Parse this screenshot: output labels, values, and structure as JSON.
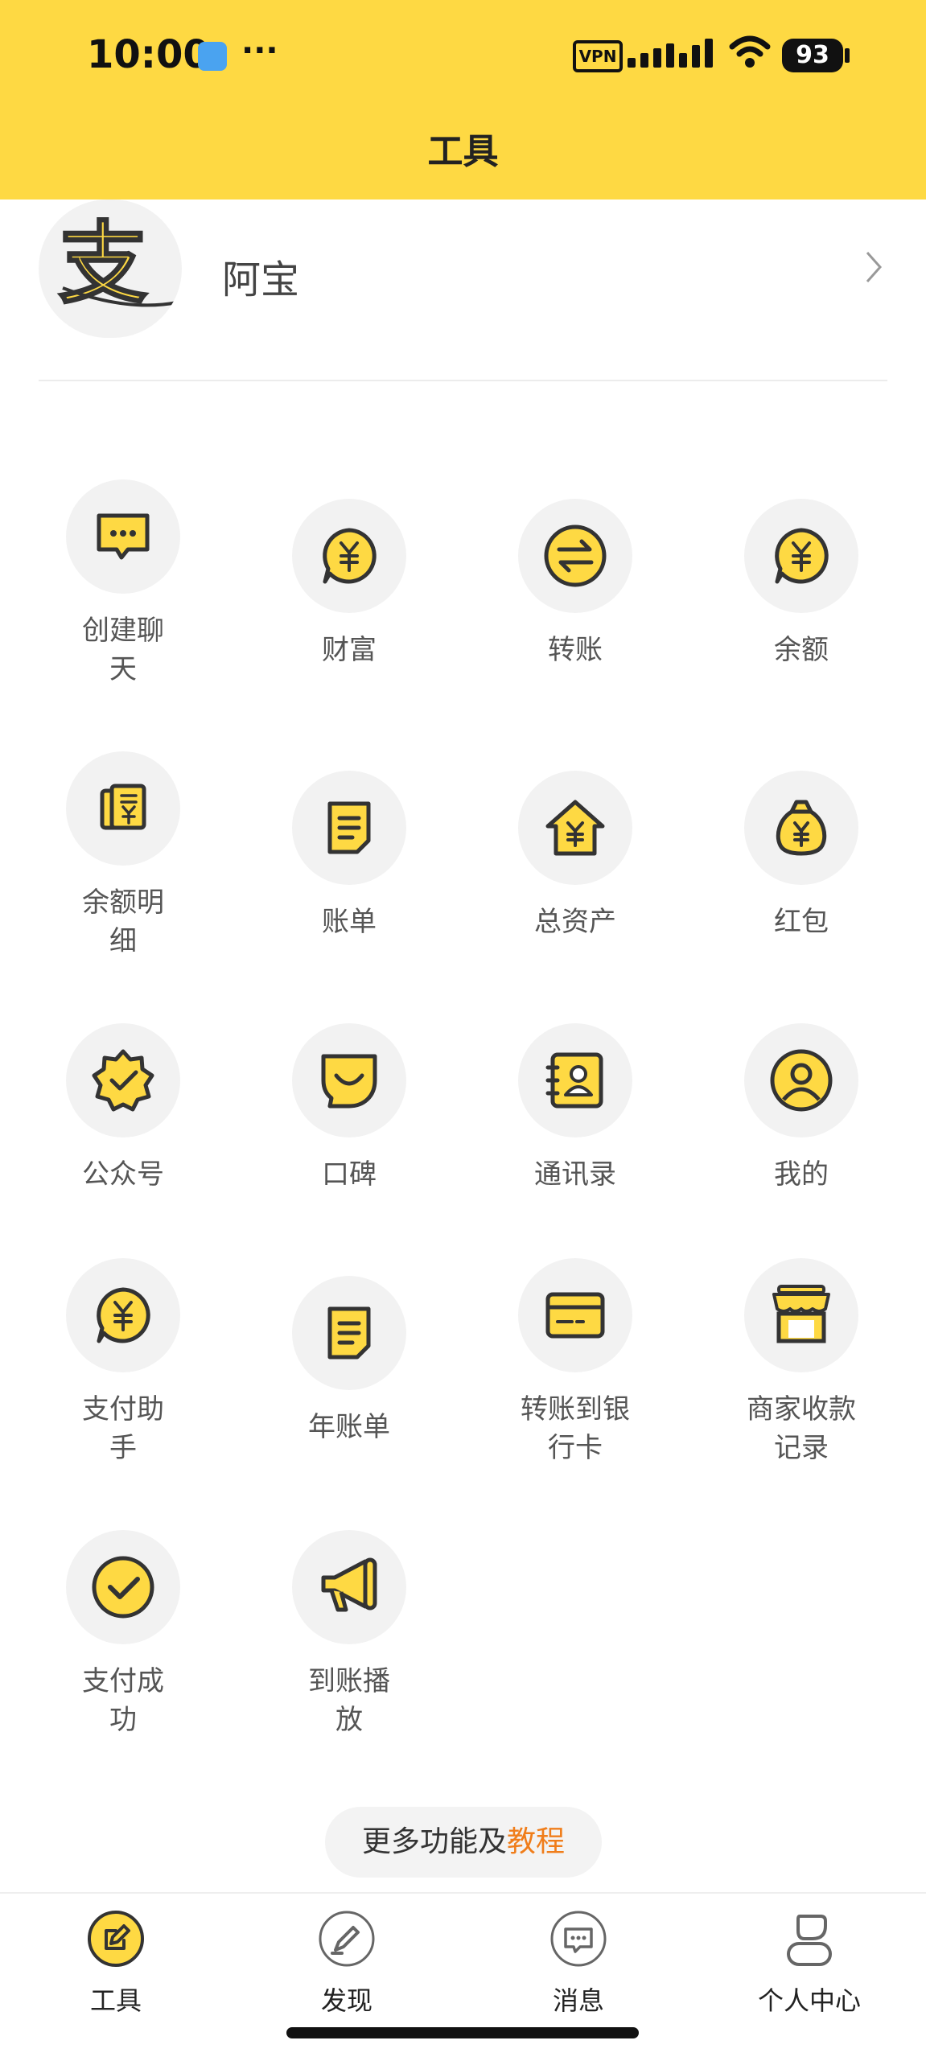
{
  "status_bar": {
    "time": "10:00",
    "more": "···",
    "vpn": "VPN",
    "battery": "93"
  },
  "header": {
    "title": "工具"
  },
  "profile": {
    "name": "阿宝",
    "avatar_glyph": "支"
  },
  "tools": [
    {
      "label": "创建聊天",
      "icon": "chat-bubble-icon"
    },
    {
      "label": "财富",
      "icon": "yuan-bubble-icon"
    },
    {
      "label": "转账",
      "icon": "transfer-arrows-icon"
    },
    {
      "label": "余额",
      "icon": "yuan-bubble-icon"
    },
    {
      "label": "余额明细",
      "icon": "receipt-icon"
    },
    {
      "label": "账单",
      "icon": "bill-icon"
    },
    {
      "label": "总资产",
      "icon": "house-yuan-icon"
    },
    {
      "label": "红包",
      "icon": "money-bag-icon"
    },
    {
      "label": "公众号",
      "icon": "badge-check-icon"
    },
    {
      "label": "口碑",
      "icon": "smile-icon"
    },
    {
      "label": "通讯录",
      "icon": "contacts-icon"
    },
    {
      "label": "我的",
      "icon": "user-circle-icon"
    },
    {
      "label": "支付助手",
      "icon": "yuan-bubble-icon"
    },
    {
      "label": "年账单",
      "icon": "bill-icon"
    },
    {
      "label": "转账到银行卡",
      "icon": "bank-card-icon"
    },
    {
      "label": "商家收款记录",
      "icon": "storefront-icon"
    },
    {
      "label": "支付成功",
      "icon": "check-circle-icon"
    },
    {
      "label": "到账播放",
      "icon": "megaphone-icon"
    }
  ],
  "more_link": {
    "text": "更多功能及",
    "accent": "教程"
  },
  "tabs": [
    {
      "label": "工具",
      "icon": "edit-icon",
      "active": true
    },
    {
      "label": "发现",
      "icon": "pen-circle-icon",
      "active": false
    },
    {
      "label": "消息",
      "icon": "message-icon",
      "active": false
    },
    {
      "label": "个人中心",
      "icon": "person-icon",
      "active": false
    }
  ],
  "colors": {
    "brand": "#FED943",
    "accent": "#F07D1A",
    "icon_stroke": "#333333"
  }
}
